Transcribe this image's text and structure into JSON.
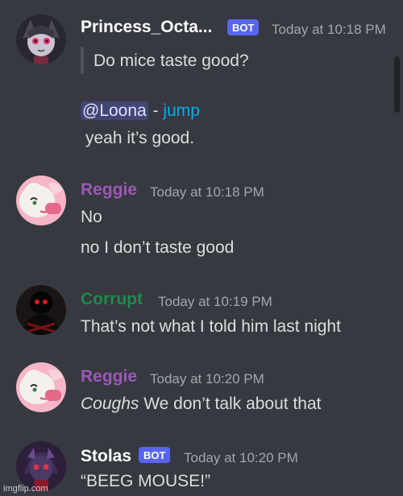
{
  "colors": {
    "background": "#36393f",
    "bot_badge": "#5865f2",
    "reggie": "#9b59b6",
    "corrupt": "#1f8b4c",
    "default_name": "#ffffff",
    "timestamp": "#a3a6aa",
    "link": "#00aff4"
  },
  "messages": [
    {
      "author": "Princess_Octa...",
      "badge": "BOT",
      "timestamp": "Today at 10:18 PM",
      "quote": "Do mice taste good?",
      "mention": "@Loona",
      "dash": "-",
      "jump": "jump",
      "text": "yeah it’s good."
    },
    {
      "author": "Reggie",
      "timestamp": "Today at 10:18 PM",
      "lines": [
        "No",
        "no I don’t taste good"
      ]
    },
    {
      "author": "Corrupt",
      "timestamp": "Today at 10:19 PM",
      "lines": [
        "That’s not what I told him last night"
      ]
    },
    {
      "author": "Reggie",
      "timestamp": "Today at 10:20 PM",
      "emph": "Coughs",
      "rest": " We don’t talk about that"
    },
    {
      "author": "Stolas",
      "badge": "BOT",
      "timestamp": "Today at 10:20 PM",
      "lines": [
        "“BEEG MOUSE!”"
      ]
    }
  ],
  "watermark": "imgflip.com"
}
